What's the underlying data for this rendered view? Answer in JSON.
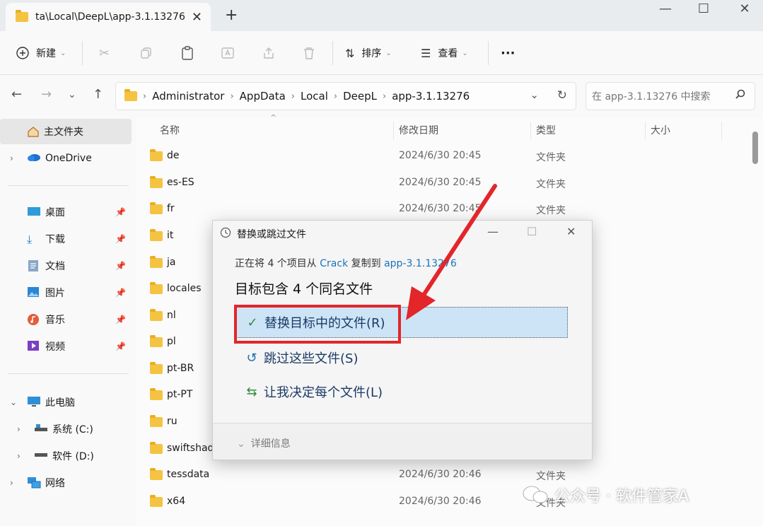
{
  "tab": {
    "title": "ta\\Local\\DeepL\\app-3.1.13276",
    "close": "✕",
    "add": "+"
  },
  "window": {
    "minimize": "—",
    "maximize": "☐",
    "close": "✕"
  },
  "toolbar": {
    "new_label": "新建",
    "sort_label": "排序",
    "view_label": "查看",
    "more": "···"
  },
  "address": {
    "crumbs": [
      "Administrator",
      "AppData",
      "Local",
      "DeepL",
      "app-3.1.13276"
    ],
    "search_placeholder": "在 app-3.1.13276 中搜索"
  },
  "sidebar": {
    "home": "主文件夹",
    "onedrive": "OneDrive",
    "quick": [
      "桌面",
      "下载",
      "文档",
      "图片",
      "音乐",
      "视频"
    ],
    "this_pc": "此电脑",
    "drives": [
      "系统 (C:)",
      "软件 (D:)"
    ],
    "network": "网络"
  },
  "columns": {
    "name": "名称",
    "date": "修改日期",
    "type": "类型",
    "size": "大小"
  },
  "files": [
    {
      "name": "de",
      "date": "2024/6/30 20:45",
      "type": "文件夹"
    },
    {
      "name": "es-ES",
      "date": "2024/6/30 20:45",
      "type": "文件夹"
    },
    {
      "name": "fr",
      "date": "2024/6/30 20:45",
      "type": "文件夹"
    },
    {
      "name": "it",
      "date": "",
      "type": ""
    },
    {
      "name": "ja",
      "date": "",
      "type": ""
    },
    {
      "name": "locales",
      "date": "",
      "type": ""
    },
    {
      "name": "nl",
      "date": "",
      "type": ""
    },
    {
      "name": "pl",
      "date": "",
      "type": ""
    },
    {
      "name": "pt-BR",
      "date": "",
      "type": ""
    },
    {
      "name": "pt-PT",
      "date": "",
      "type": ""
    },
    {
      "name": "ru",
      "date": "",
      "type": ""
    },
    {
      "name": "swiftshad",
      "date": "",
      "type": ""
    },
    {
      "name": "tessdata",
      "date": "2024/6/30 20:46",
      "type": "文件夹"
    },
    {
      "name": "x64",
      "date": "2024/6/30 20:46",
      "type": "文件夹"
    }
  ],
  "dialog": {
    "title": "替换或跳过文件",
    "msg_prefix": "正在将 4 个项目从 ",
    "msg_src": "Crack",
    "msg_mid": " 复制到 ",
    "msg_dst": "app-3.1.13276",
    "heading": "目标包含 4 个同名文件",
    "options": [
      "替换目标中的文件(R)",
      "跳过这些文件(S)",
      "让我决定每个文件(L)"
    ],
    "details": "详细信息"
  },
  "watermark": "公众号 · 软件管家A"
}
